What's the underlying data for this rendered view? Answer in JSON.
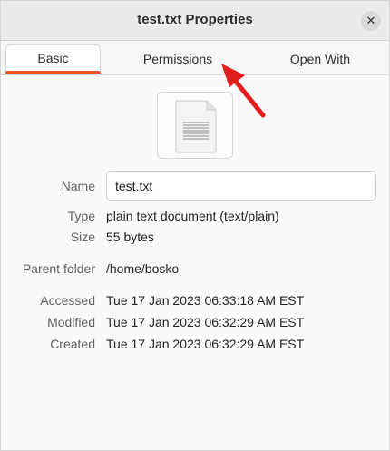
{
  "window": {
    "title": "test.txt Properties",
    "close_symbol": "✕"
  },
  "tabs": [
    {
      "label": "Basic",
      "active": true
    },
    {
      "label": "Permissions",
      "active": false
    },
    {
      "label": "Open With",
      "active": false
    }
  ],
  "file": {
    "icon": "text-file-icon"
  },
  "properties": {
    "name_label": "Name",
    "name_value": "test.txt",
    "type_label": "Type",
    "type_value": "plain text document (text/plain)",
    "size_label": "Size",
    "size_value": "55 bytes",
    "parent_label": "Parent folder",
    "parent_value": "/home/bosko",
    "accessed_label": "Accessed",
    "accessed_value": "Tue 17 Jan 2023 06:33:18 AM EST",
    "modified_label": "Modified",
    "modified_value": "Tue 17 Jan 2023 06:32:29 AM EST",
    "created_label": "Created",
    "created_value": "Tue 17 Jan 2023 06:32:29 AM EST"
  },
  "colors": {
    "accent": "#e95420",
    "annotation_arrow": "#e31c1c"
  }
}
